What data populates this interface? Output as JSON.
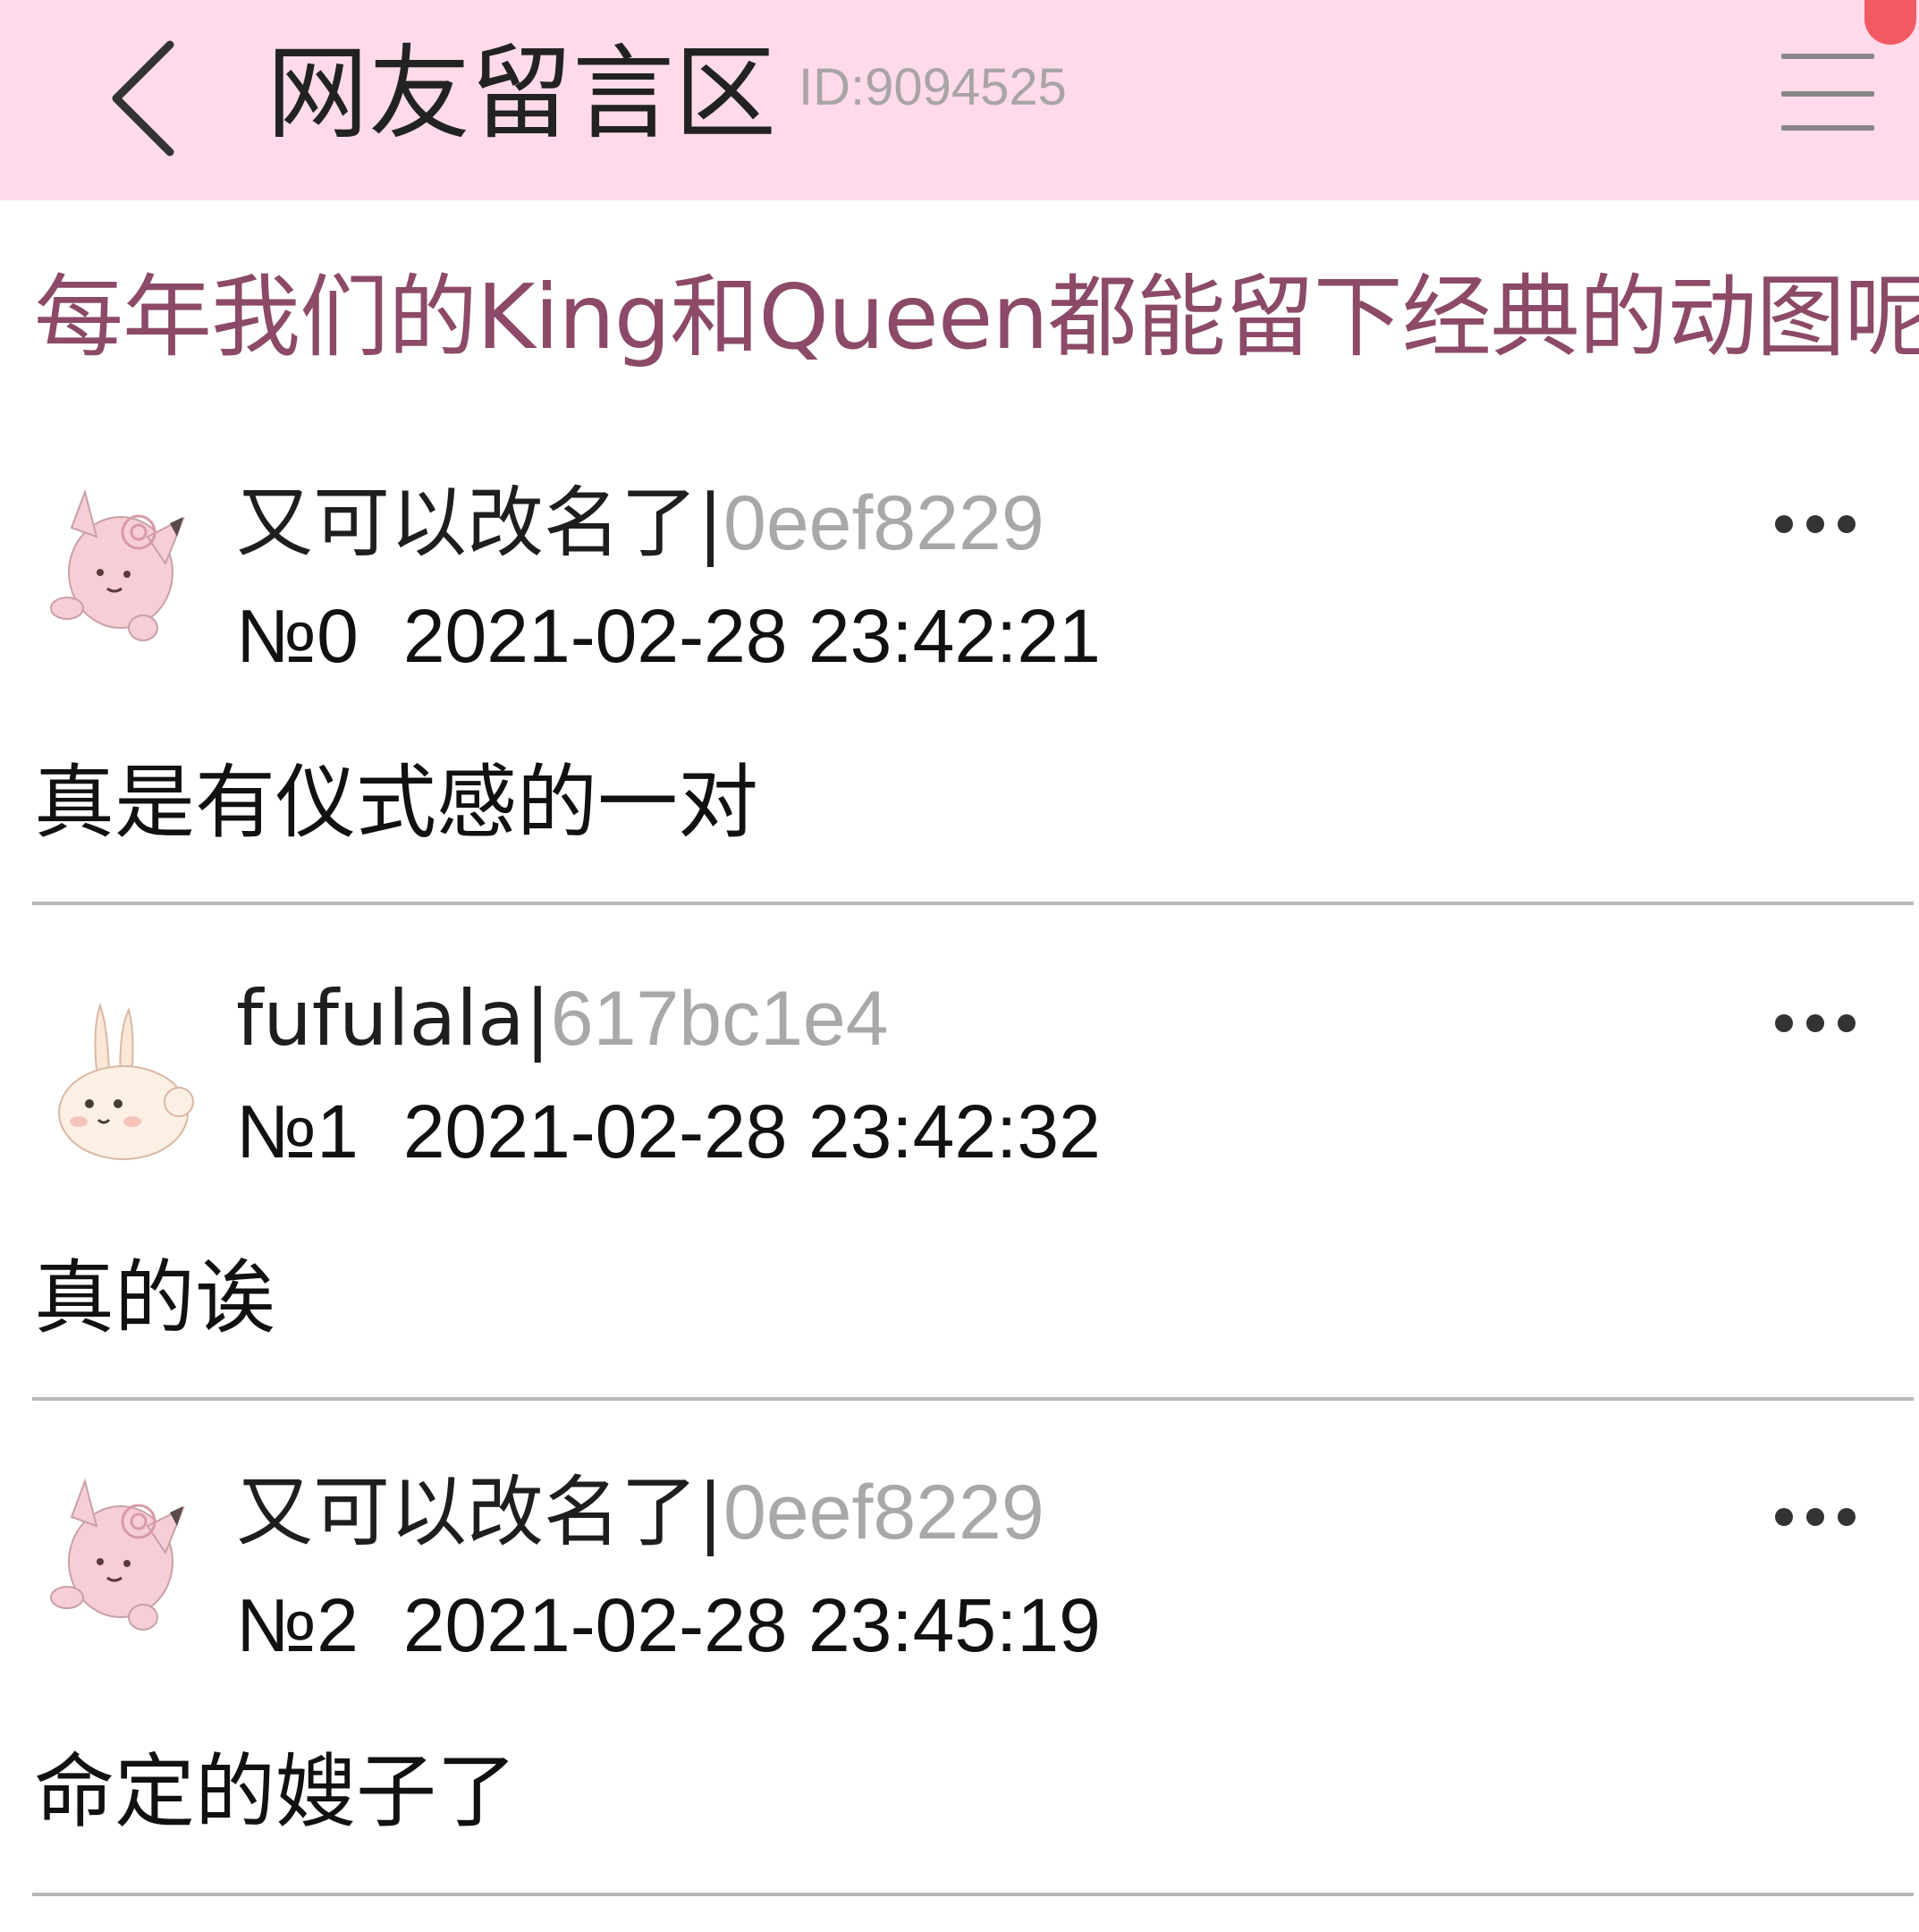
{
  "header": {
    "title": "网友留言区",
    "id_label": "ID:9094525",
    "back_icon": "chevron-left-icon",
    "menu_icon": "hamburger-menu-icon",
    "notification_color": "#f25a62",
    "background_color": "#ffdaeb"
  },
  "subtitle": "每年我们的King和Queen都能留下经典的动图呢",
  "comments": [
    {
      "author": "又可以改名了",
      "separator": "|",
      "user_id": "0eef8229",
      "floor": "№0",
      "timestamp": "2021-02-28 23:42:21",
      "body": "真是有仪式感的一对",
      "avatar": "pink-fairy-avatar"
    },
    {
      "author": "fufulala",
      "separator": "|",
      "user_id": "617bc1e4",
      "floor": "№1",
      "timestamp": "2021-02-28 23:42:32",
      "body": "真的诶",
      "avatar": "cream-rabbit-avatar"
    },
    {
      "author": "又可以改名了",
      "separator": "|",
      "user_id": "0eef8229",
      "floor": "№2",
      "timestamp": "2021-02-28 23:45:19",
      "body": "命定的嫂子了",
      "avatar": "pink-fairy-avatar"
    }
  ],
  "colors": {
    "subtitle": "#8c4a68",
    "user_id": "#a8a8a8",
    "divider": "#b8b8b8"
  }
}
